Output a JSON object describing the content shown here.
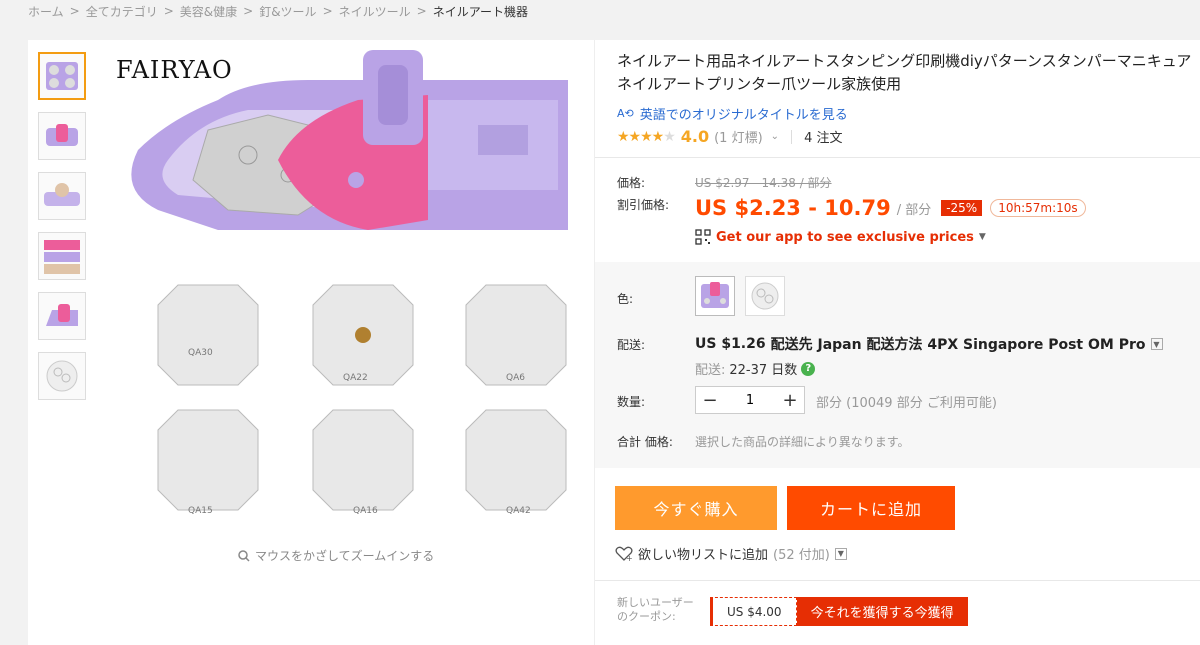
{
  "breadcrumb": [
    "ホーム",
    "全てカテゴリ",
    "美容&健康",
    "釘&ツール",
    "ネイルツール",
    "ネイルアート機器"
  ],
  "gallery": {
    "brand": "FAIRYAO",
    "zoom_hint": "マウスをかざしてズームインする",
    "plate_codes": [
      "QA30",
      "QA22",
      "QA6",
      "QA15",
      "QA16",
      "QA42"
    ]
  },
  "product": {
    "title": "ネイルアート用品ネイルアートスタンピング印刷機diyパターンスタンパーマニキュアネイルアートプリンター爪ツール家族使用",
    "translate_link": "英語でのオリジナルタイトルを見る",
    "rating": "4.0",
    "rating_count": "(1 灯標)",
    "orders": "4 注文"
  },
  "price": {
    "label": "価格:",
    "original": "US $2.97 - 14.38 / 部分",
    "discount_label": "割引価格:",
    "discount": "US $2.23 - 10.79",
    "unit": "/ 部分",
    "badge": "-25%",
    "timer": "10h:57m:10s",
    "app_promo": "Get our app to see exclusive prices"
  },
  "options": {
    "color_label": "色:",
    "shipping_label": "配送:",
    "shipping_price": "US $1.26",
    "shipping_text": "配送先 Japan 配送方法 4PX Singapore Post OM Pro",
    "delivery_prefix": "配送:",
    "delivery_days": "22-37 日数",
    "qty_label": "数量:",
    "qty_value": "1",
    "availability": "部分 (10049 部分 ご利用可能)",
    "total_label": "合計 価格:",
    "total_note": "選択した商品の詳細により異なります。"
  },
  "actions": {
    "buy_now": "今すぐ購入",
    "add_cart": "カートに追加",
    "wishlist": "欲しい物リストに追加",
    "wishlist_count": "(52 付加)"
  },
  "coupon": {
    "label": "新しいユーザーのクーポン:",
    "amount": "US $4.00",
    "get": "今それを獲得する今獲得"
  },
  "colors": {
    "accent": "#ff4a00",
    "buy": "#ff9a2d",
    "cart": "#ff4b00",
    "badge": "#e62e04",
    "stars": "#f5a623",
    "link": "#2a6bd1",
    "machine_purple": "#b9a3e6",
    "machine_pink": "#ec5d9a"
  }
}
